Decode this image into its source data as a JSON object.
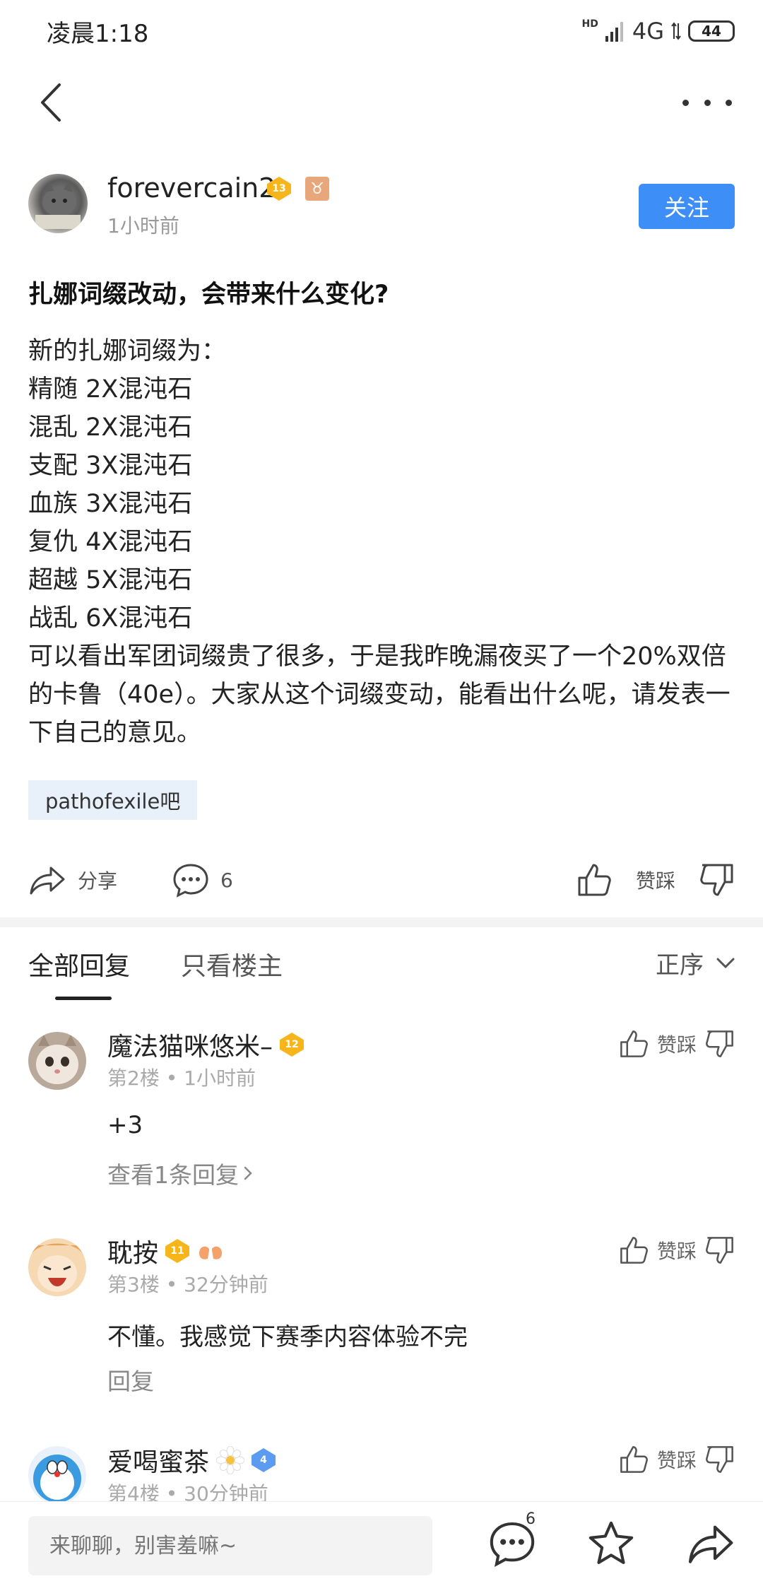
{
  "status": {
    "time": "凌晨1:18",
    "hd": "HD",
    "network": "4G",
    "battery": "44"
  },
  "author": {
    "name": "forevercain2",
    "level": "13",
    "zodiac": "♉",
    "time": "1小时前",
    "follow_label": "关注"
  },
  "post": {
    "title": "扎娜词缀改动，会带来什么变化?",
    "lines": [
      "新的扎娜词缀为：",
      "精随 2X混沌石",
      "混乱 2X混沌石",
      "支配 3X混沌石",
      "血族 3X混沌石",
      "复仇 4X混沌石",
      "超越 5X混沌石",
      "战乱 6X混沌石"
    ],
    "paragraph": "可以看出军团词缀贵了很多，于是我昨晚漏夜买了一个20%双倍的卡鲁（40e）。大家从这个词缀变动，能看出什么呢，请发表一下自己的意见。",
    "tag": "pathofexile吧"
  },
  "actions": {
    "share_label": "分享",
    "comment_count": "6",
    "vote_label": "赞踩"
  },
  "tabs": {
    "all": "全部回复",
    "op_only": "只看楼主",
    "sort": "正序"
  },
  "comments": [
    {
      "name": "魔法猫咪悠米–",
      "level": "12",
      "floor": "第2楼",
      "time": "1小时前",
      "text": "+3",
      "reply": "查看1条回复",
      "vote": "赞踩"
    },
    {
      "name": "耽按",
      "level": "11",
      "floor": "第3楼",
      "time": "32分钟前",
      "text": "不懂。我感觉下赛季内容体验不完",
      "reply": "回复",
      "vote": "赞踩"
    },
    {
      "name": "爱喝蜜茶",
      "level": "4",
      "floor": "第4楼",
      "time": "30分钟前",
      "vote": "赞踩"
    }
  ],
  "bottom": {
    "placeholder": "来聊聊，别害羞嘛~",
    "comment_count": "6"
  },
  "colors": {
    "accent": "#3e8ef7",
    "level_badge": "#f5b51b",
    "tag_bg": "#e8f1fa"
  }
}
